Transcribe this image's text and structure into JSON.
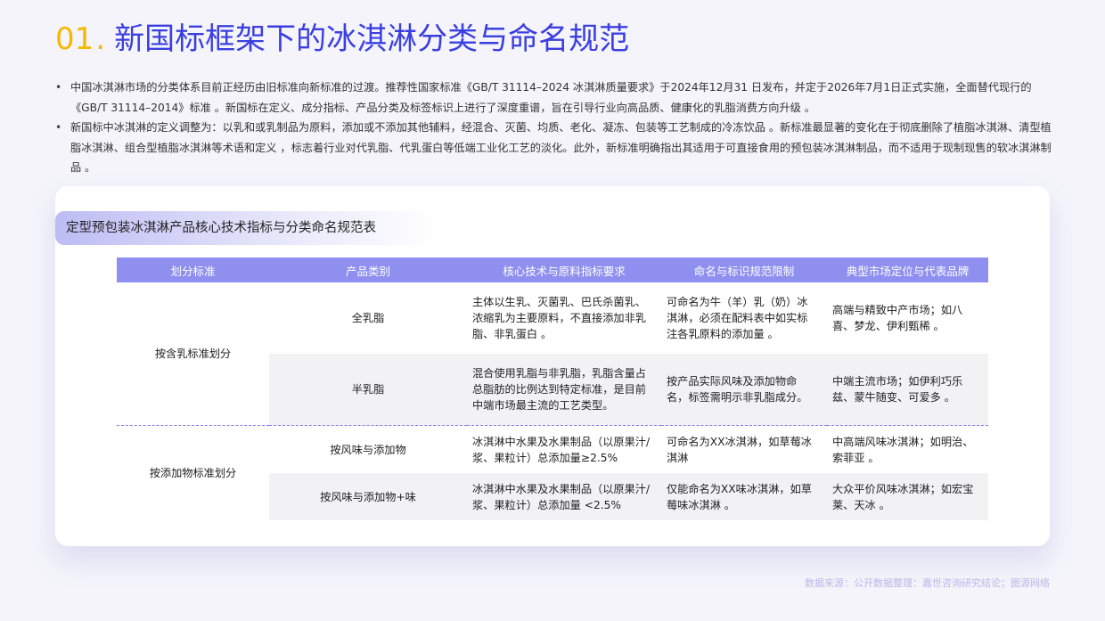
{
  "header": {
    "number": "01",
    "dot": ".",
    "title": "新国标框架下的冰淇淋分类与命名规范"
  },
  "bullets": [
    "中国冰淇淋市场的分类体系目前正经历由旧标准向新标准的过渡。推荐性国家标准《GB/T 31114–2024 冰淇淋质量要求》于2024年12月31 日发布，并定于2026年7月1日正式实施，全面替代现行的《GB/T 31114–2014》标准 。新国标在定义、成分指标、产品分类及标签标识上进行了深度重谱，旨在引导行业向高品质、健康化的乳脂消费方向升级 。",
    "新国标中冰淇淋的定义调整为：以乳和或乳制品为原料，添加或不添加其他辅料，经混合、灭菌、均质、老化、凝冻、包装等工艺制成的冷冻饮品 。新标准最显著的变化在于彻底删除了植脂冰淇淋、清型植脂冰淇淋、组合型植脂冰淇淋等术语和定义 ，标志着行业对代乳脂、代乳蛋白等低端工业化工艺的淡化。此外，新标准明确指出其适用于可直接食用的预包装冰淇淋制品，而不适用于现制现售的软冰淇淋制品 。"
  ],
  "card": {
    "title": "定型预包装冰淇淋产品核心技术指标与分类命名规范表",
    "columns": [
      "划分标准",
      "产品类别",
      "核心技术与原料指标要求",
      "命名与标识规范限制",
      "典型市场定位与代表品牌"
    ],
    "groups": [
      {
        "label": "按含乳标准划分",
        "rows": [
          {
            "category": "全乳脂",
            "requirement": "主体以生乳、灭菌乳、巴氏杀菌乳、浓缩乳为主要原料，不直接添加非乳脂、非乳蛋白 。",
            "naming": "可命名为牛（羊）乳（奶）冰淇淋，必须在配料表中如实标注各乳原料的添加量 。",
            "market": "高端与精致中产市场；如八喜、梦龙、伊利甄稀 。"
          },
          {
            "category": "半乳脂",
            "requirement": "混合使用乳脂与非乳脂，乳脂含量占总脂肪的比例达到特定标准，是目前中端市场最主流的工艺类型。",
            "naming": "按产品实际风味及添加物命名，标签需明示非乳脂成分。",
            "market": "中端主流市场；如伊利巧乐兹、蒙牛随变、可爱多 。"
          }
        ]
      },
      {
        "label": "按添加物标准划分",
        "rows": [
          {
            "category": "按风味与添加物",
            "requirement": "冰淇淋中水果及水果制品（以原果汁/浆、果粒计）总添加量≥2.5%",
            "naming": "可命名为XX冰淇淋，如草莓冰淇淋",
            "market": "中高端风味冰淇淋；如明治、索菲亚 。"
          },
          {
            "category": "按风味与添加物+味",
            "requirement": "冰淇淋中水果及水果制品（以原果汁/浆、果粒计）总添加量 <2.5%",
            "naming": "仅能命名为XX味冰淇淋，如草莓味冰淇淋 。",
            "market": "大众平价风味冰淇淋；如宏宝莱、天冰 。"
          }
        ]
      }
    ]
  },
  "footer": {
    "source": "数据来源：公开数据整理：嘉世咨询研究结论；图源网络"
  }
}
